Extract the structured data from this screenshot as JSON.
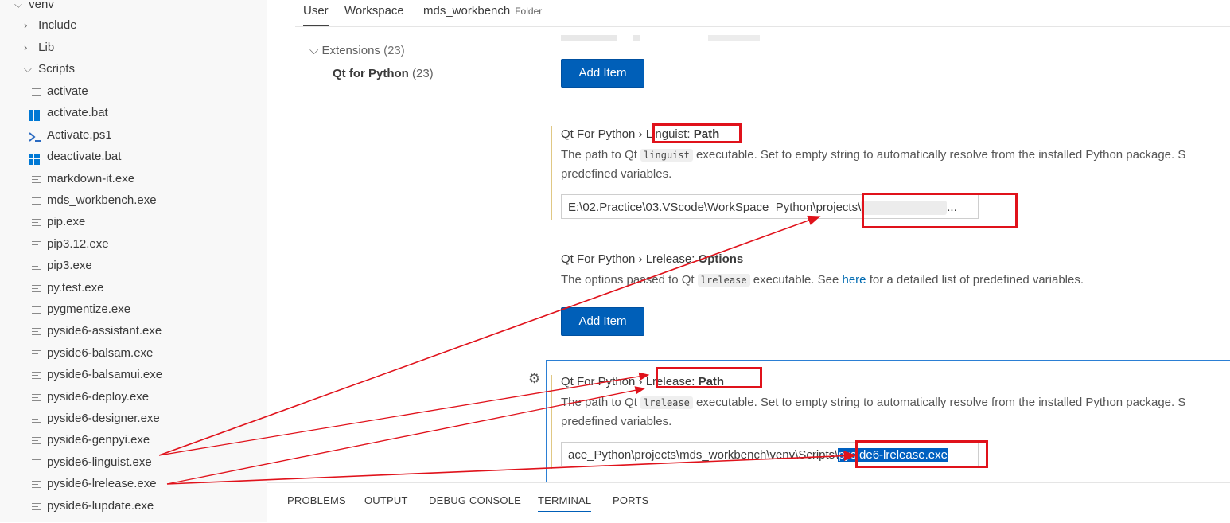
{
  "explorer": {
    "root": "venv",
    "folders": [
      {
        "label": "Include",
        "expanded": false
      },
      {
        "label": "Lib",
        "expanded": false
      },
      {
        "label": "Scripts",
        "expanded": true
      }
    ],
    "files": [
      {
        "label": "activate",
        "icon": "lines-file-icon"
      },
      {
        "label": "activate.bat",
        "icon": "windows-icon"
      },
      {
        "label": "Activate.ps1",
        "icon": "powershell-icon"
      },
      {
        "label": "deactivate.bat",
        "icon": "windows-icon"
      },
      {
        "label": "markdown-it.exe",
        "icon": "lines-file-icon"
      },
      {
        "label": "mds_workbench.exe",
        "icon": "lines-file-icon"
      },
      {
        "label": "pip.exe",
        "icon": "lines-file-icon"
      },
      {
        "label": "pip3.12.exe",
        "icon": "lines-file-icon"
      },
      {
        "label": "pip3.exe",
        "icon": "lines-file-icon"
      },
      {
        "label": "py.test.exe",
        "icon": "lines-file-icon"
      },
      {
        "label": "pygmentize.exe",
        "icon": "lines-file-icon"
      },
      {
        "label": "pyside6-assistant.exe",
        "icon": "lines-file-icon"
      },
      {
        "label": "pyside6-balsam.exe",
        "icon": "lines-file-icon"
      },
      {
        "label": "pyside6-balsamui.exe",
        "icon": "lines-file-icon"
      },
      {
        "label": "pyside6-deploy.exe",
        "icon": "lines-file-icon"
      },
      {
        "label": "pyside6-designer.exe",
        "icon": "lines-file-icon"
      },
      {
        "label": "pyside6-genpyi.exe",
        "icon": "lines-file-icon"
      },
      {
        "label": "pyside6-linguist.exe",
        "icon": "lines-file-icon"
      },
      {
        "label": "pyside6-lrelease.exe",
        "icon": "lines-file-icon"
      },
      {
        "label": "pyside6-lupdate.exe",
        "icon": "lines-file-icon"
      }
    ]
  },
  "settings_tabs": {
    "user": "User",
    "workspace": "Workspace",
    "folder": "mds_workbench",
    "folder_badge": "Folder"
  },
  "toc": {
    "extensions": "Extensions",
    "extensions_count": "(23)",
    "qt": "Qt for Python",
    "qt_count": "(23)"
  },
  "settings": {
    "add_item_1": "Add Item",
    "linguist": {
      "prefix": "Qt For Python › ",
      "cat": "Linguist: ",
      "name": "Path",
      "desc_a": "The path to Qt ",
      "code": "linguist",
      "desc_b": " executable. Set to empty string to automatically resolve from the installed Python package. S",
      "desc_c": "predefined variables.",
      "value": "E:\\02.Practice\\03.VScode\\WorkSpace_Python\\projects\\",
      "value_tail": "..."
    },
    "lrelease_options": {
      "prefix": "Qt For Python › ",
      "cat": "Lrelease: ",
      "name": "Options",
      "desc_a": "The options passed to Qt ",
      "code": "lrelease",
      "desc_b": " executable. See ",
      "link": "here",
      "desc_c": " for a detailed list of predefined variables.",
      "button": "Add Item"
    },
    "lrelease_path": {
      "prefix": "Qt For Python › ",
      "cat": "Lrelease: ",
      "name": "Path",
      "desc_a": "The path to Qt ",
      "code": "lrelease",
      "desc_b": " executable. Set to empty string to automatically resolve from the installed Python package. S",
      "desc_c": "predefined variables.",
      "value": "ace_Python\\projects\\mds_workbench\\venv\\Scripts\\",
      "value_selected": "pyside6-lrelease.exe"
    }
  },
  "panel_tabs": [
    "PROBLEMS",
    "OUTPUT",
    "DEBUG CONSOLE",
    "TERMINAL",
    "PORTS"
  ],
  "colors": {
    "accent": "#005fb8",
    "annotation_red": "#e0121b",
    "modified_bar": "#e0c884"
  }
}
